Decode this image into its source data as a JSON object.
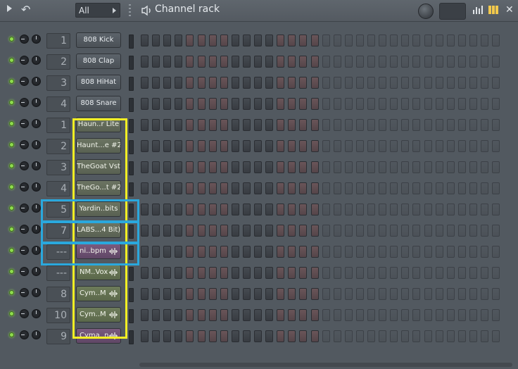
{
  "toolbar": {
    "filter_value": "All",
    "title": "Channel rack"
  },
  "channels": [
    {
      "num": "1",
      "name": "808 Kick"
    },
    {
      "num": "2",
      "name": "808 Clap"
    },
    {
      "num": "3",
      "name": "808 HiHat"
    },
    {
      "num": "4",
      "name": "808 Snare"
    },
    {
      "num": "1",
      "name": "Haun..r Lite"
    },
    {
      "num": "2",
      "name": "Haunt...e #2"
    },
    {
      "num": "3",
      "name": "TheGoat Vst"
    },
    {
      "num": "4",
      "name": "TheGo...t #2"
    },
    {
      "num": "5",
      "name": "Yardin..bits"
    },
    {
      "num": "7",
      "name": "LABS...4 Bit)"
    },
    {
      "num": "---",
      "name": "ni..bpm"
    },
    {
      "num": "---",
      "name": "NM..Vox"
    },
    {
      "num": "8",
      "name": "Cym..M"
    },
    {
      "num": "10",
      "name": "Cym..M"
    },
    {
      "num": "9",
      "name": "Cyma..n"
    }
  ],
  "colors": {
    "highlight_yellow": "#f2ee23",
    "highlight_blue": "#2aa8dd",
    "led_green": "#8fdc4e"
  }
}
